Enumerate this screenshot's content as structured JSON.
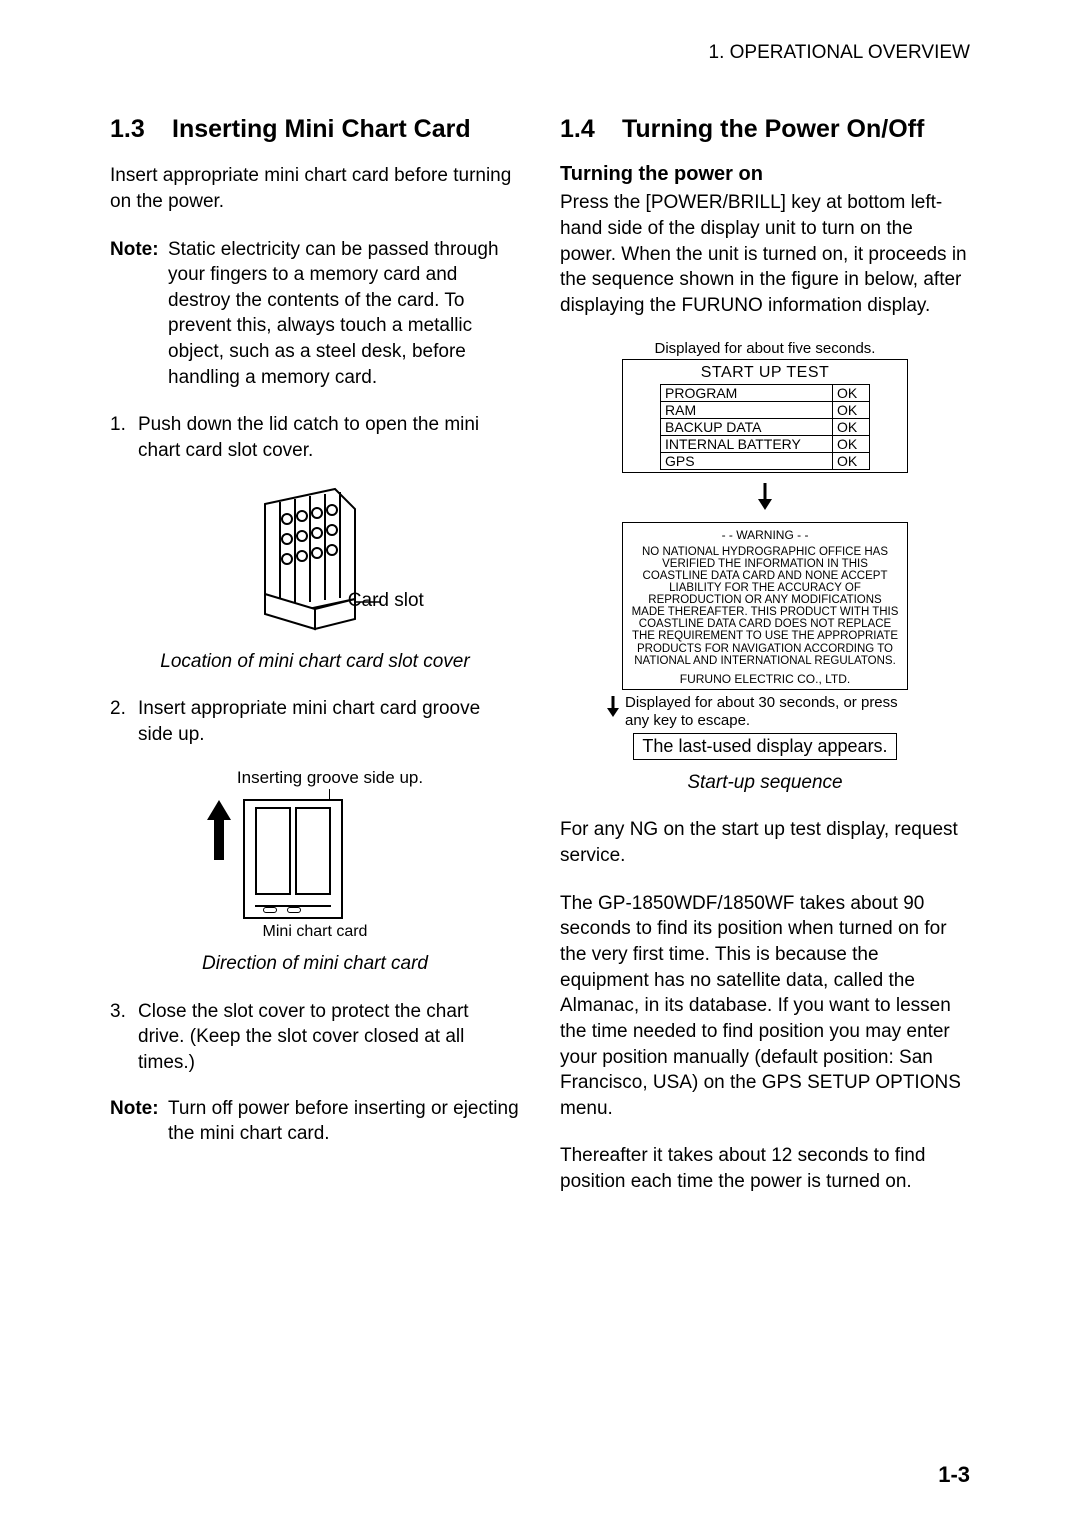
{
  "header": "1. OPERATIONAL OVERVIEW",
  "left": {
    "heading_num": "1.3",
    "heading_text": "Inserting Mini Chart Card",
    "intro": "Insert appropriate mini chart card before turning on the power.",
    "note1_label": "Note:",
    "note1_text": "Static electricity can be passed through your fingers to a memory card and destroy the contents of the card. To prevent this, always touch a metallic object, such as a steel desk, before handling a memory card.",
    "step1_n": "1.",
    "step1_t": "Push down the lid catch to open the mini chart card slot cover.",
    "fig1_label": "Card slot",
    "fig1_caption": "Location of mini chart card slot cover",
    "step2_n": "2.",
    "step2_t": "Insert appropriate mini chart card groove side up.",
    "fig2_top": "Inserting groove side up.",
    "fig2_small": "Mini chart card",
    "fig2_caption": "Direction of mini chart card",
    "step3_n": "3.",
    "step3_t": "Close the slot cover to protect the chart drive. (Keep the slot cover closed at all times.)",
    "note2_label": "Note:",
    "note2_text": "Turn off power before inserting or ejecting the mini chart card."
  },
  "right": {
    "heading_num": "1.4",
    "heading_text": "Turning the Power On/Off",
    "sub1": "Turning the power on",
    "p1": "Press the [POWER/BRILL] key at bottom left-hand side of the display unit to turn on the power. When the unit is turned on, it proceeds in the sequence shown in the figure in below, after displaying the FURUNO information display.",
    "seq_top": "Displayed for about five seconds.",
    "startup_title": "START UP TEST",
    "rows": [
      {
        "k": "PROGRAM",
        "v": "OK"
      },
      {
        "k": "RAM",
        "v": "OK"
      },
      {
        "k": "BACKUP DATA",
        "v": "OK"
      },
      {
        "k": "INTERNAL BATTERY",
        "v": "OK"
      },
      {
        "k": "GPS",
        "v": "OK"
      }
    ],
    "warn_title": "- - WARNING - -",
    "warn_body": "NO NATIONAL HYDROGRAPHIC OFFICE HAS VERIFIED THE INFORMATION IN THIS COASTLINE DATA CARD AND NONE ACCEPT LIABILITY FOR THE ACCURACY OF REPRODUCTION OR ANY MODIFICATIONS MADE THEREAFTER. THIS PRODUCT WITH THIS COASTLINE DATA CARD DOES NOT REPLACE THE REQUIREMENT TO USE THE APPROPRIATE PRODUCTS FOR NAVIGATION ACCORDING TO NATIONAL AND INTERNATIONAL REGULATONS.",
    "warn_company": "FURUNO ELECTRIC CO., LTD.",
    "seq_note": "Displayed for about 30 seconds, or press any key to escape.",
    "last_box": "The last-used display appears.",
    "seq_caption": "Start-up sequence",
    "p2": "For any NG on the start up test display, request service.",
    "p3": "The GP-1850WDF/1850WF takes about 90 seconds to find its position when turned on for the very first time. This is because the equipment has no satellite data, called the Almanac, in its database. If you want to lessen the time needed to find position you may enter your position manually (default position: San Francisco, USA) on the GPS SETUP OPTIONS menu.",
    "p4": "Thereafter it takes about 12 seconds to find position each time the power is turned on."
  },
  "page_number": "1-3"
}
